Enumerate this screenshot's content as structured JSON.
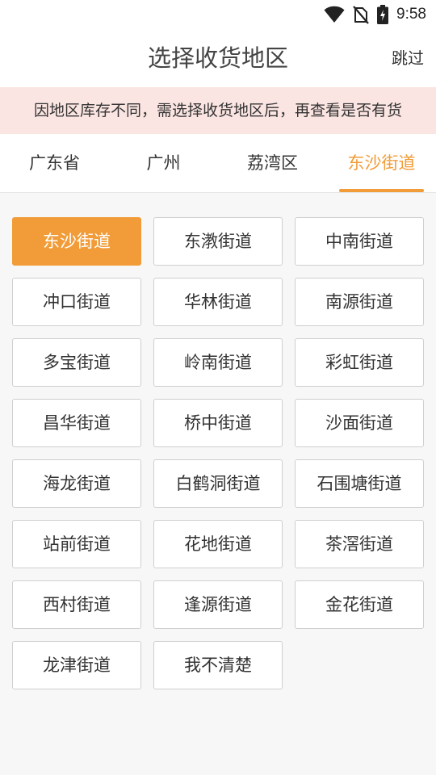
{
  "status_bar": {
    "time": "9:58",
    "icons": [
      "wifi-icon",
      "no-sim-icon",
      "battery-charging-icon"
    ]
  },
  "header": {
    "title": "选择收货地区",
    "skip_label": "跳过"
  },
  "notice": {
    "text": "因地区库存不同，需选择收货地区后，再查看是否有货"
  },
  "tabs": [
    {
      "label": "广东省",
      "active": false
    },
    {
      "label": "广州",
      "active": false
    },
    {
      "label": "荔湾区",
      "active": false
    },
    {
      "label": "东沙街道",
      "active": true
    }
  ],
  "streets": [
    {
      "label": "东沙街道",
      "selected": true
    },
    {
      "label": "东漖街道",
      "selected": false
    },
    {
      "label": "中南街道",
      "selected": false
    },
    {
      "label": "冲口街道",
      "selected": false
    },
    {
      "label": "华林街道",
      "selected": false
    },
    {
      "label": "南源街道",
      "selected": false
    },
    {
      "label": "多宝街道",
      "selected": false
    },
    {
      "label": "岭南街道",
      "selected": false
    },
    {
      "label": "彩虹街道",
      "selected": false
    },
    {
      "label": "昌华街道",
      "selected": false
    },
    {
      "label": "桥中街道",
      "selected": false
    },
    {
      "label": "沙面街道",
      "selected": false
    },
    {
      "label": "海龙街道",
      "selected": false
    },
    {
      "label": "白鹤洞街道",
      "selected": false
    },
    {
      "label": "石围塘街道",
      "selected": false
    },
    {
      "label": "站前街道",
      "selected": false
    },
    {
      "label": "花地街道",
      "selected": false
    },
    {
      "label": "茶滘街道",
      "selected": false
    },
    {
      "label": "西村街道",
      "selected": false
    },
    {
      "label": "逢源街道",
      "selected": false
    },
    {
      "label": "金花街道",
      "selected": false
    },
    {
      "label": "龙津街道",
      "selected": false
    },
    {
      "label": "我不清楚",
      "selected": false
    }
  ],
  "colors": {
    "accent": "#f19c38",
    "notice_bg": "#fbe5e2",
    "page_bg": "#f7f7f7"
  }
}
